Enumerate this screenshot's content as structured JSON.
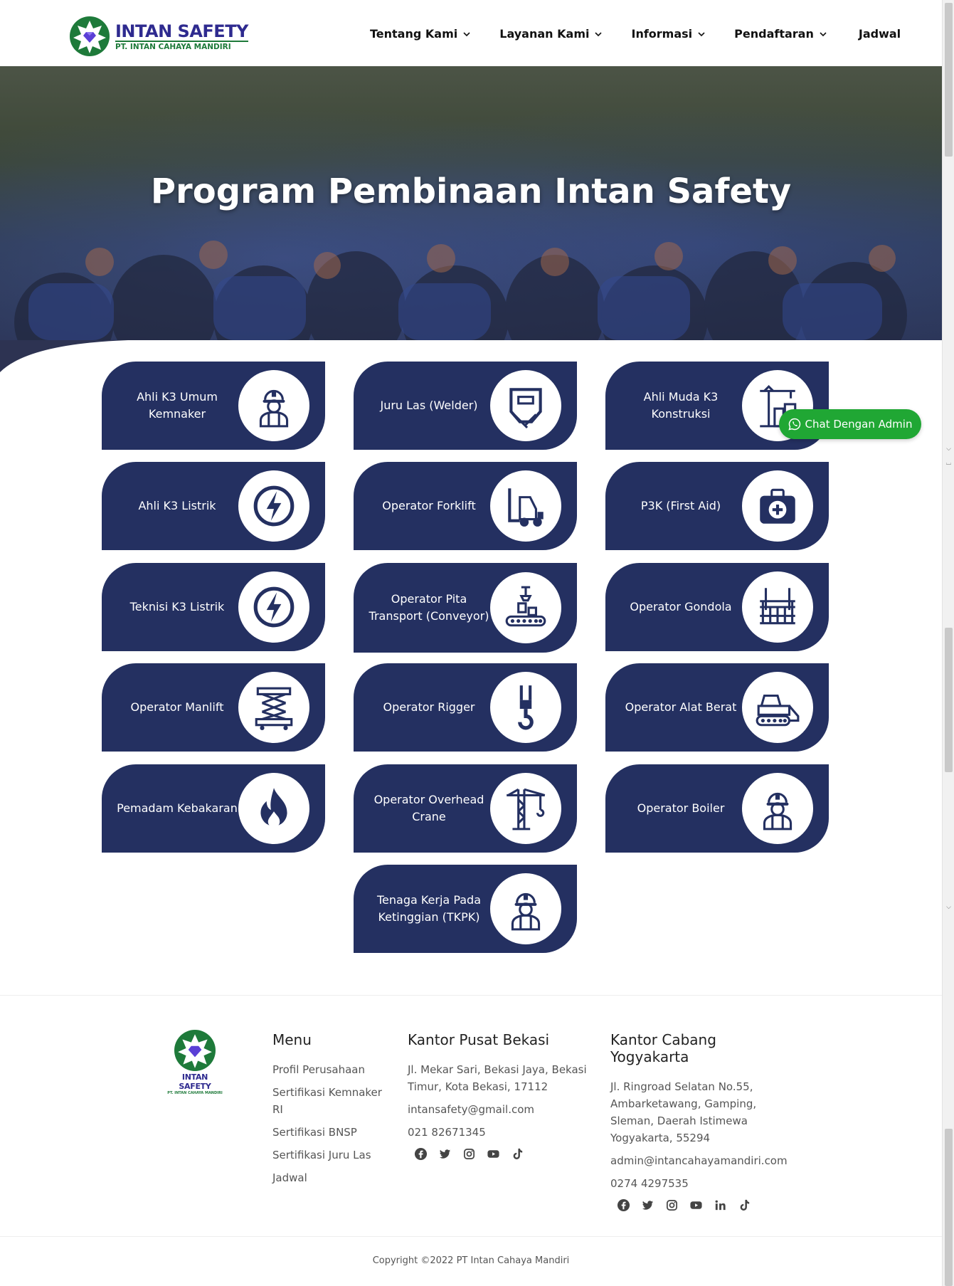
{
  "brand": {
    "name": "INTAN SAFETY",
    "company": "PT. INTAN CAHAYA MANDIRI",
    "primary_color": "#2e2a8f",
    "green_color": "#1e7a3a",
    "card_color": "#243061"
  },
  "nav": {
    "items": [
      {
        "label": "Tentang Kami",
        "dropdown": true
      },
      {
        "label": "Layanan Kami",
        "dropdown": true
      },
      {
        "label": "Informasi",
        "dropdown": true
      },
      {
        "label": "Pendaftaran",
        "dropdown": true
      },
      {
        "label": "Jadwal",
        "dropdown": false
      }
    ]
  },
  "hero": {
    "title": "Program Pembinaan Intan Safety"
  },
  "programs": [
    {
      "label": "Ahli K3 Umum Kemnaker",
      "icon": "worker-icon"
    },
    {
      "label": "Juru Las (Welder)",
      "icon": "welding-mask-icon"
    },
    {
      "label": "Ahli Muda K3 Konstruksi",
      "icon": "construction-icon"
    },
    {
      "label": "Ahli K3 Listrik",
      "icon": "lightning-icon"
    },
    {
      "label": "Operator Forklift",
      "icon": "forklift-icon"
    },
    {
      "label": "P3K (First Aid)",
      "icon": "first-aid-icon"
    },
    {
      "label": "Teknisi K3 Listrik",
      "icon": "lightning-icon"
    },
    {
      "label": "Operator Pita Transport (Conveyor)",
      "icon": "conveyor-icon"
    },
    {
      "label": "Operator Gondola",
      "icon": "gondola-icon"
    },
    {
      "label": "Operator Manlift",
      "icon": "manlift-icon"
    },
    {
      "label": "Operator Rigger",
      "icon": "hook-icon"
    },
    {
      "label": "Operator Alat Berat",
      "icon": "bulldozer-icon"
    },
    {
      "label": "Pemadam Kebakaran",
      "icon": "fire-icon"
    },
    {
      "label": "Operator Overhead Crane",
      "icon": "crane-icon"
    },
    {
      "label": "Operator Boiler",
      "icon": "worker-icon"
    },
    {
      "label": "Tenaga Kerja Pada Ketinggian (TKPK)",
      "icon": "worker-icon"
    }
  ],
  "chat": {
    "label": "Chat Dengan Admin",
    "color": "#20a734"
  },
  "footer": {
    "logo_main": "INTAN SAFETY",
    "logo_sub": "PT. INTAN CAHAYA MANDIRI",
    "menu": {
      "title": "Menu",
      "items": [
        "Profil Perusahaan",
        "Sertifikasi Kemnaker RI",
        "Sertifikasi BNSP",
        "Sertifikasi Juru Las",
        "Jadwal"
      ]
    },
    "bekasi": {
      "title": "Kantor Pusat Bekasi",
      "address": "Jl. Mekar Sari, Bekasi Jaya, Bekasi Timur, Kota Bekasi, 17112",
      "email": "intansafety@gmail.com",
      "phone": "021 82671345",
      "socials": [
        "facebook-icon",
        "twitter-icon",
        "instagram-icon",
        "youtube-icon",
        "tiktok-icon"
      ]
    },
    "yogyakarta": {
      "title": "Kantor Cabang Yogyakarta",
      "address": "Jl. Ringroad Selatan No.55, Ambarketawang, Gamping, Sleman, Daerah Istimewa Yogyakarta, 55294",
      "email": "admin@intancahayamandiri.com",
      "phone": "0274 4297535",
      "socials": [
        "facebook-icon",
        "twitter-icon",
        "instagram-icon",
        "youtube-icon",
        "linkedin-icon",
        "tiktok-icon"
      ]
    },
    "copyright": "Copyright ©2022 PT Intan Cahaya Mandiri"
  }
}
